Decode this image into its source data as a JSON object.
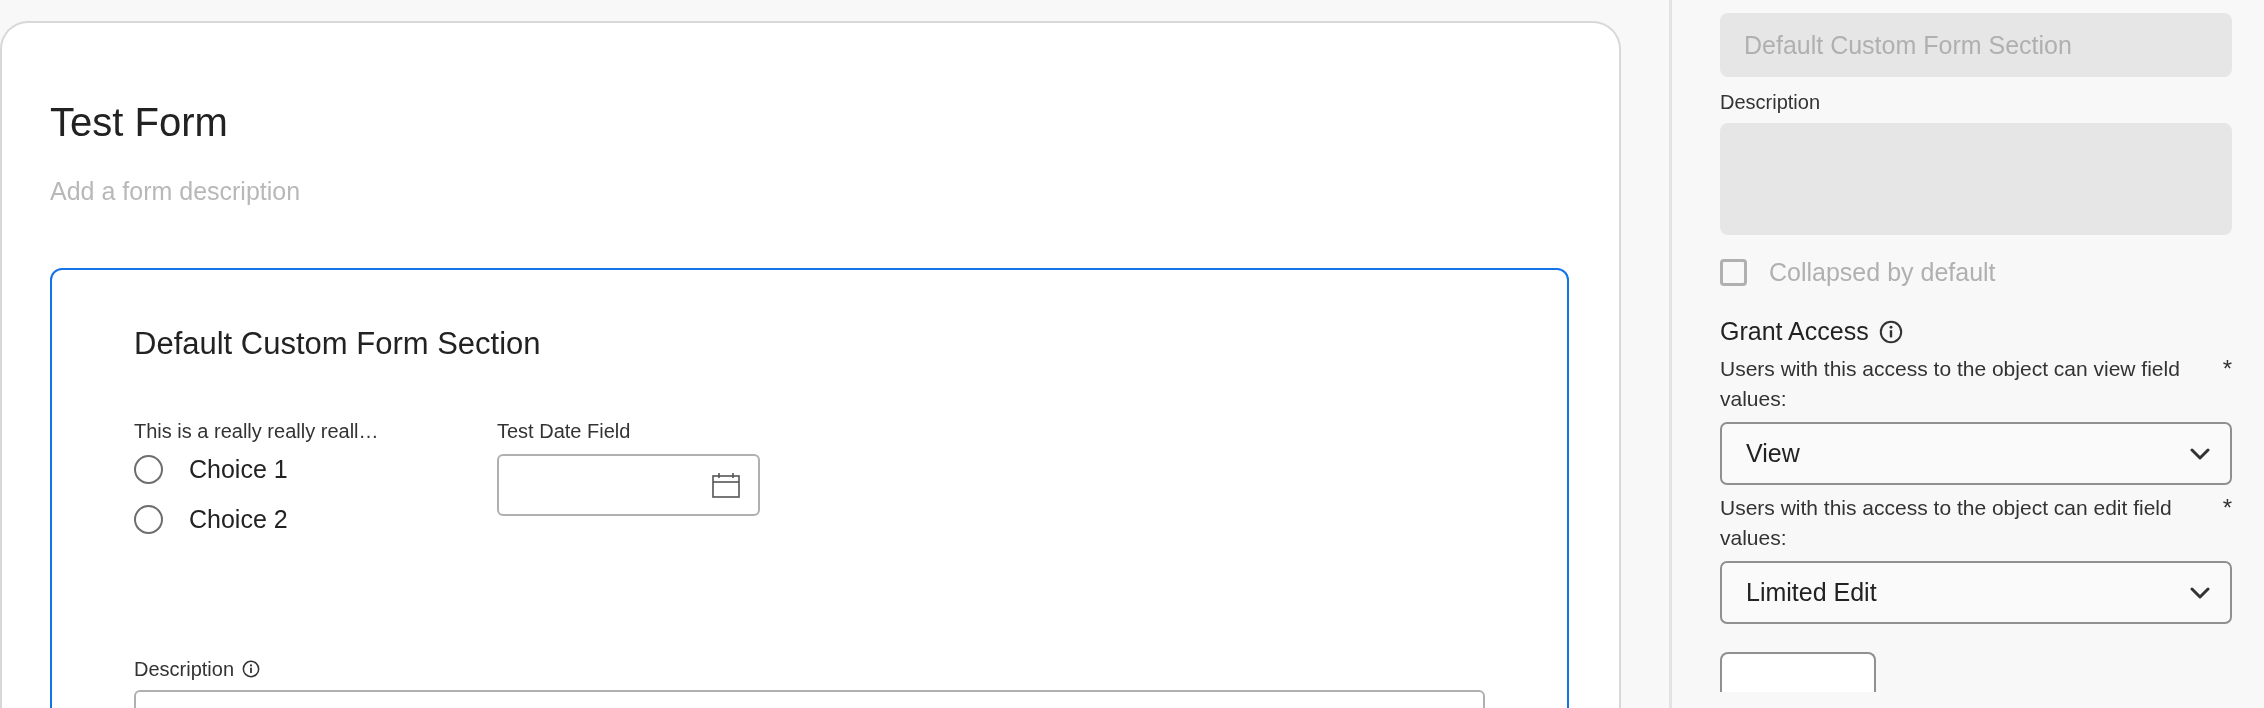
{
  "form": {
    "title": "Test Form",
    "description_placeholder": "Add a form description",
    "section": {
      "title": "Default Custom Form Section",
      "radio_field": {
        "label": "This is a really really reall…",
        "options": [
          {
            "label": "Choice 1",
            "selected": false
          },
          {
            "label": "Choice 2",
            "selected": false
          }
        ]
      },
      "date_field": {
        "label": "Test Date Field"
      },
      "description_field": {
        "label": "Description"
      }
    }
  },
  "panel": {
    "section_name": {
      "value": "Default Custom Form Section",
      "disabled": true
    },
    "description": {
      "label": "Description",
      "disabled": true
    },
    "collapsed": {
      "label": "Collapsed by default",
      "checked": false,
      "disabled": true
    },
    "grant_access": {
      "title": "Grant Access",
      "fields": [
        {
          "label": "Users with this access to the object can view field values:",
          "required_mark": "*",
          "value": "View"
        },
        {
          "label": "Users with this access to the object can edit field values:",
          "required_mark": "*",
          "value": "Limited Edit"
        }
      ]
    }
  }
}
